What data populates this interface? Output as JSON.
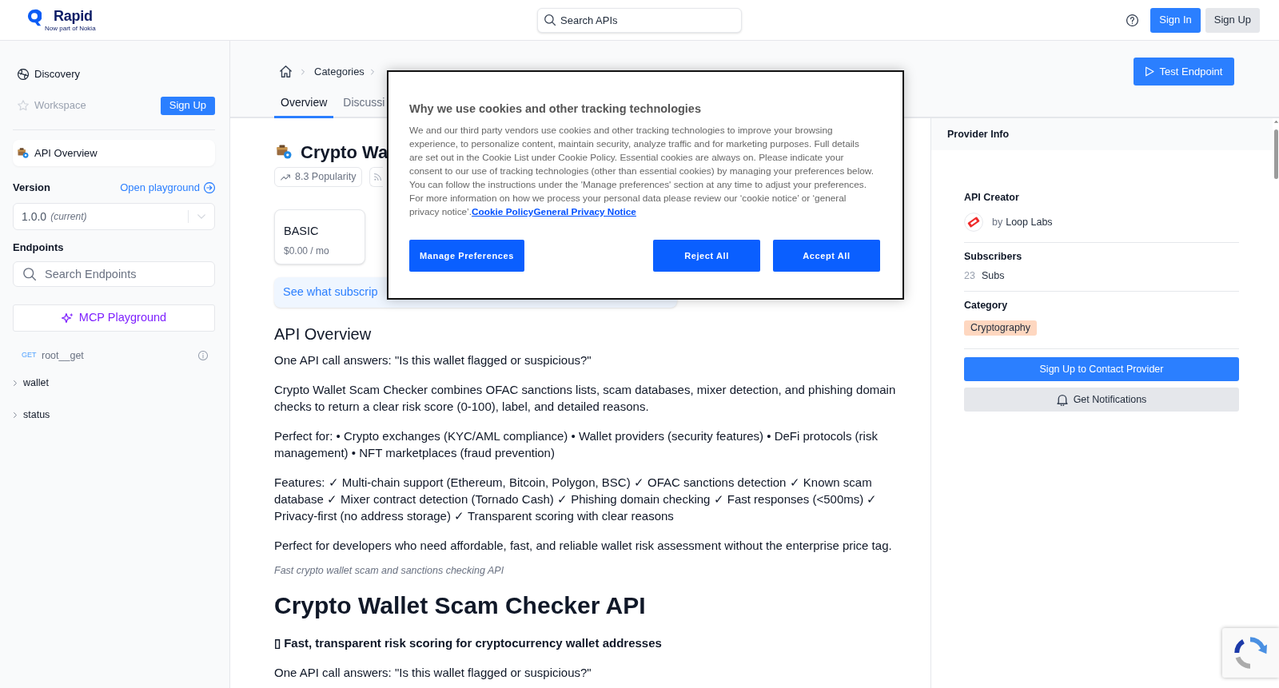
{
  "header": {
    "logo": {
      "name": "Rapid",
      "tagline": "Now part of Nokia"
    },
    "search": {
      "placeholder": "Search APIs"
    },
    "buttons": [
      {
        "label": "Sign In",
        "kind": "primary"
      },
      {
        "label": "Sign Up",
        "kind": "secondary"
      }
    ]
  },
  "sidebar": {
    "nav": [
      {
        "label": "Discovery",
        "disabled": false
      },
      {
        "label": "Workspace",
        "disabled": true,
        "action": "Sign Up"
      }
    ],
    "api_overview": {
      "label": "API Overview",
      "selected": true
    },
    "version": {
      "label": "Version",
      "link": "Open playground",
      "value": "1.0.0",
      "note": "(current)"
    },
    "endpoints": {
      "label": "Endpoints",
      "search": {
        "placeholder": "Search Endpoints"
      },
      "mcp_button": "MCP Playground",
      "items": [
        {
          "kind": "endpoint",
          "method": "GET",
          "label": "root__get"
        },
        {
          "kind": "group",
          "label": "wallet",
          "expanded": false
        },
        {
          "kind": "group",
          "label": "status",
          "expanded": false
        }
      ]
    }
  },
  "main": {
    "breadcrumbs": [
      {
        "label": "Categories"
      }
    ],
    "tabs": [
      {
        "label": "Overview",
        "selected": true
      },
      {
        "label": "Discussi",
        "selected": false
      }
    ],
    "test_button": "Test Endpoint",
    "api": {
      "title": "Crypto Wa",
      "popularity": "8.3 Popularity"
    },
    "plans": [
      {
        "name": "BASIC",
        "price": "$0.00 / mo"
      }
    ],
    "banner": "See what subscrip",
    "content": [
      {
        "kind": "h2",
        "text": "API Overview"
      },
      {
        "kind": "p",
        "text": "One API call answers: \"Is this wallet flagged or suspicious?\""
      },
      {
        "kind": "p",
        "text": "Crypto Wallet Scam Checker combines OFAC sanctions lists, scam databases, mixer detection, and phishing domain checks to return a clear risk score (0-100), label, and detailed reasons."
      },
      {
        "kind": "p",
        "text": "Perfect for: • Crypto exchanges (KYC/AML compliance) • Wallet providers (security features) • DeFi protocols (risk management) • NFT marketplaces (fraud prevention)"
      },
      {
        "kind": "p",
        "text": "Features: ✓ Multi-chain support (Ethereum, Bitcoin, Polygon, BSC) ✓ OFAC sanctions detection ✓ Known scam database ✓ Mixer contract detection (Tornado Cash) ✓ Phishing domain checking ✓ Fast responses (<500ms) ✓ Privacy-first (no address storage) ✓ Transparent scoring with clear reasons"
      },
      {
        "kind": "p",
        "text": "Perfect for developers who need affordable, fast, and reliable wallet risk assessment without the enterprise price tag."
      },
      {
        "kind": "caption",
        "text": "Fast crypto wallet scam and sanctions checking API"
      },
      {
        "kind": "h1",
        "text": "Crypto Wallet Scam Checker API"
      },
      {
        "kind": "lead",
        "text": "▯ Fast, transparent risk scoring for cryptocurrency wallet addresses"
      },
      {
        "kind": "p",
        "text": "One API call answers: \"Is this wallet flagged or suspicious?\""
      }
    ]
  },
  "provider_info": {
    "title": "Provider Info",
    "sections": [
      {
        "kind": "creator",
        "label": "API Creator",
        "prefix": "by",
        "value": "Loop Labs"
      },
      {
        "kind": "stat",
        "label": "Subscribers",
        "count": "23",
        "unit": "Subs"
      },
      {
        "kind": "tag",
        "label": "Category",
        "tag": "Cryptography"
      }
    ],
    "buttons": [
      {
        "label": "Sign Up to Contact Provider",
        "kind": "primary"
      },
      {
        "label": "Get Notifications",
        "kind": "secondary"
      }
    ]
  },
  "cookie_dialog": {
    "title": "Why we use cookies and other tracking technologies",
    "body": "We and our third party vendors use cookies and other tracking technologies to improve your browsing experience, to personalize content, maintain security, analyze traffic and for marketing purposes. Full details are set out in the Cookie List under Cookie Policy. Essential cookies are always on. Please indicate your consent to our use of tracking technologies (other than essential cookies) by managing your preferences below. You can follow the instructions under the 'Manage preferences' section at any time to adjust your preferences. For more information on how we process your personal data please review our ‘cookie notice’ or ‘general privacy notice’.",
    "links": [
      "Cookie Policy",
      "General Privacy Notice"
    ],
    "buttons": [
      {
        "label": "Manage Preferences"
      },
      {
        "label": "Reject All"
      },
      {
        "label": "Accept All"
      }
    ]
  }
}
